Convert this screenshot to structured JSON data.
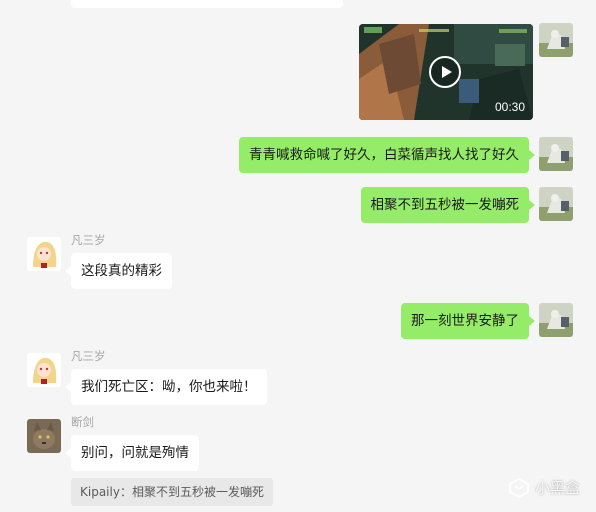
{
  "video_message": {
    "duration": "00:30"
  },
  "messages": {
    "m1": {
      "text": "青青喊救命喊了好久，白菜循声找人找了好久"
    },
    "m2": {
      "text": "相聚不到五秒被一发嘣死"
    },
    "m3": {
      "sender": "凡三岁",
      "text": "这段真的精彩"
    },
    "m4": {
      "text": "那一刻世界安静了"
    },
    "m5": {
      "sender": "凡三岁",
      "text": "我们死亡区：呦，你也来啦！"
    },
    "m6": {
      "sender": "断剑",
      "text": "别问，问就是殉情"
    }
  },
  "quote": {
    "text": "Kipaily：相聚不到五秒被一发嘣死"
  },
  "watermark": {
    "text": "小黑盒"
  },
  "colors": {
    "background": "#f5f5f5",
    "outgoing_bubble": "#95ec69",
    "incoming_bubble": "#ffffff",
    "sender_name": "#a6a6a6"
  }
}
